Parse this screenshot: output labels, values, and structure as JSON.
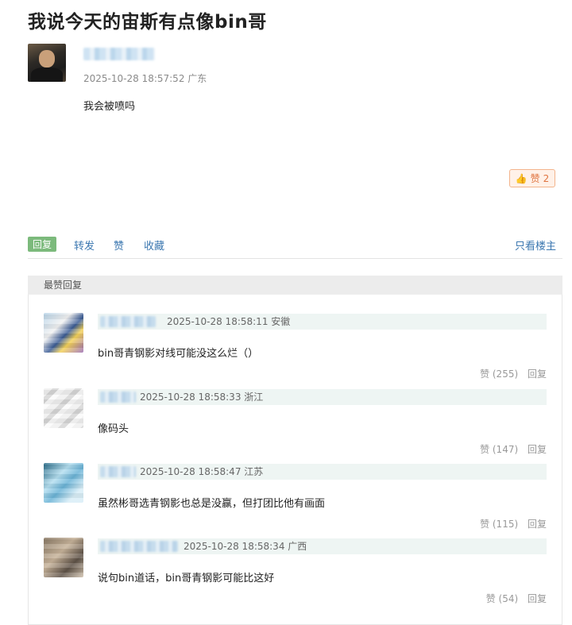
{
  "post": {
    "title": "我说今天的宙斯有点像bin哥",
    "time": "2025-10-28 18:57:52",
    "location": "广东",
    "body": "我会被喷吗",
    "like_label": "赞",
    "like_count": "2"
  },
  "actions": {
    "reply": "回复",
    "forward": "转发",
    "like": "赞",
    "favorite": "收藏",
    "only_op": "只看楼主"
  },
  "hot": {
    "header": "最赞回复",
    "replies": [
      {
        "time": "2025-10-28 18:58:11",
        "location": "安徽",
        "text": "bin哥青钢影对线可能没这么烂（）",
        "likes": "赞 (255)",
        "reply": "回复"
      },
      {
        "time": "2025-10-28 18:58:33",
        "location": "浙江",
        "text": "像码头",
        "likes": "赞 (147)",
        "reply": "回复"
      },
      {
        "time": "2025-10-28 18:58:47",
        "location": "江苏",
        "text": "虽然彬哥选青钢影也总是没赢，但打团比他有画面",
        "likes": "赞 (115)",
        "reply": "回复"
      },
      {
        "time": "2025-10-28 18:58:34",
        "location": "广西",
        "text": "说句bin道话，bin哥青钢影可能比这好",
        "likes": "赞 (54)",
        "reply": "回复"
      }
    ]
  }
}
